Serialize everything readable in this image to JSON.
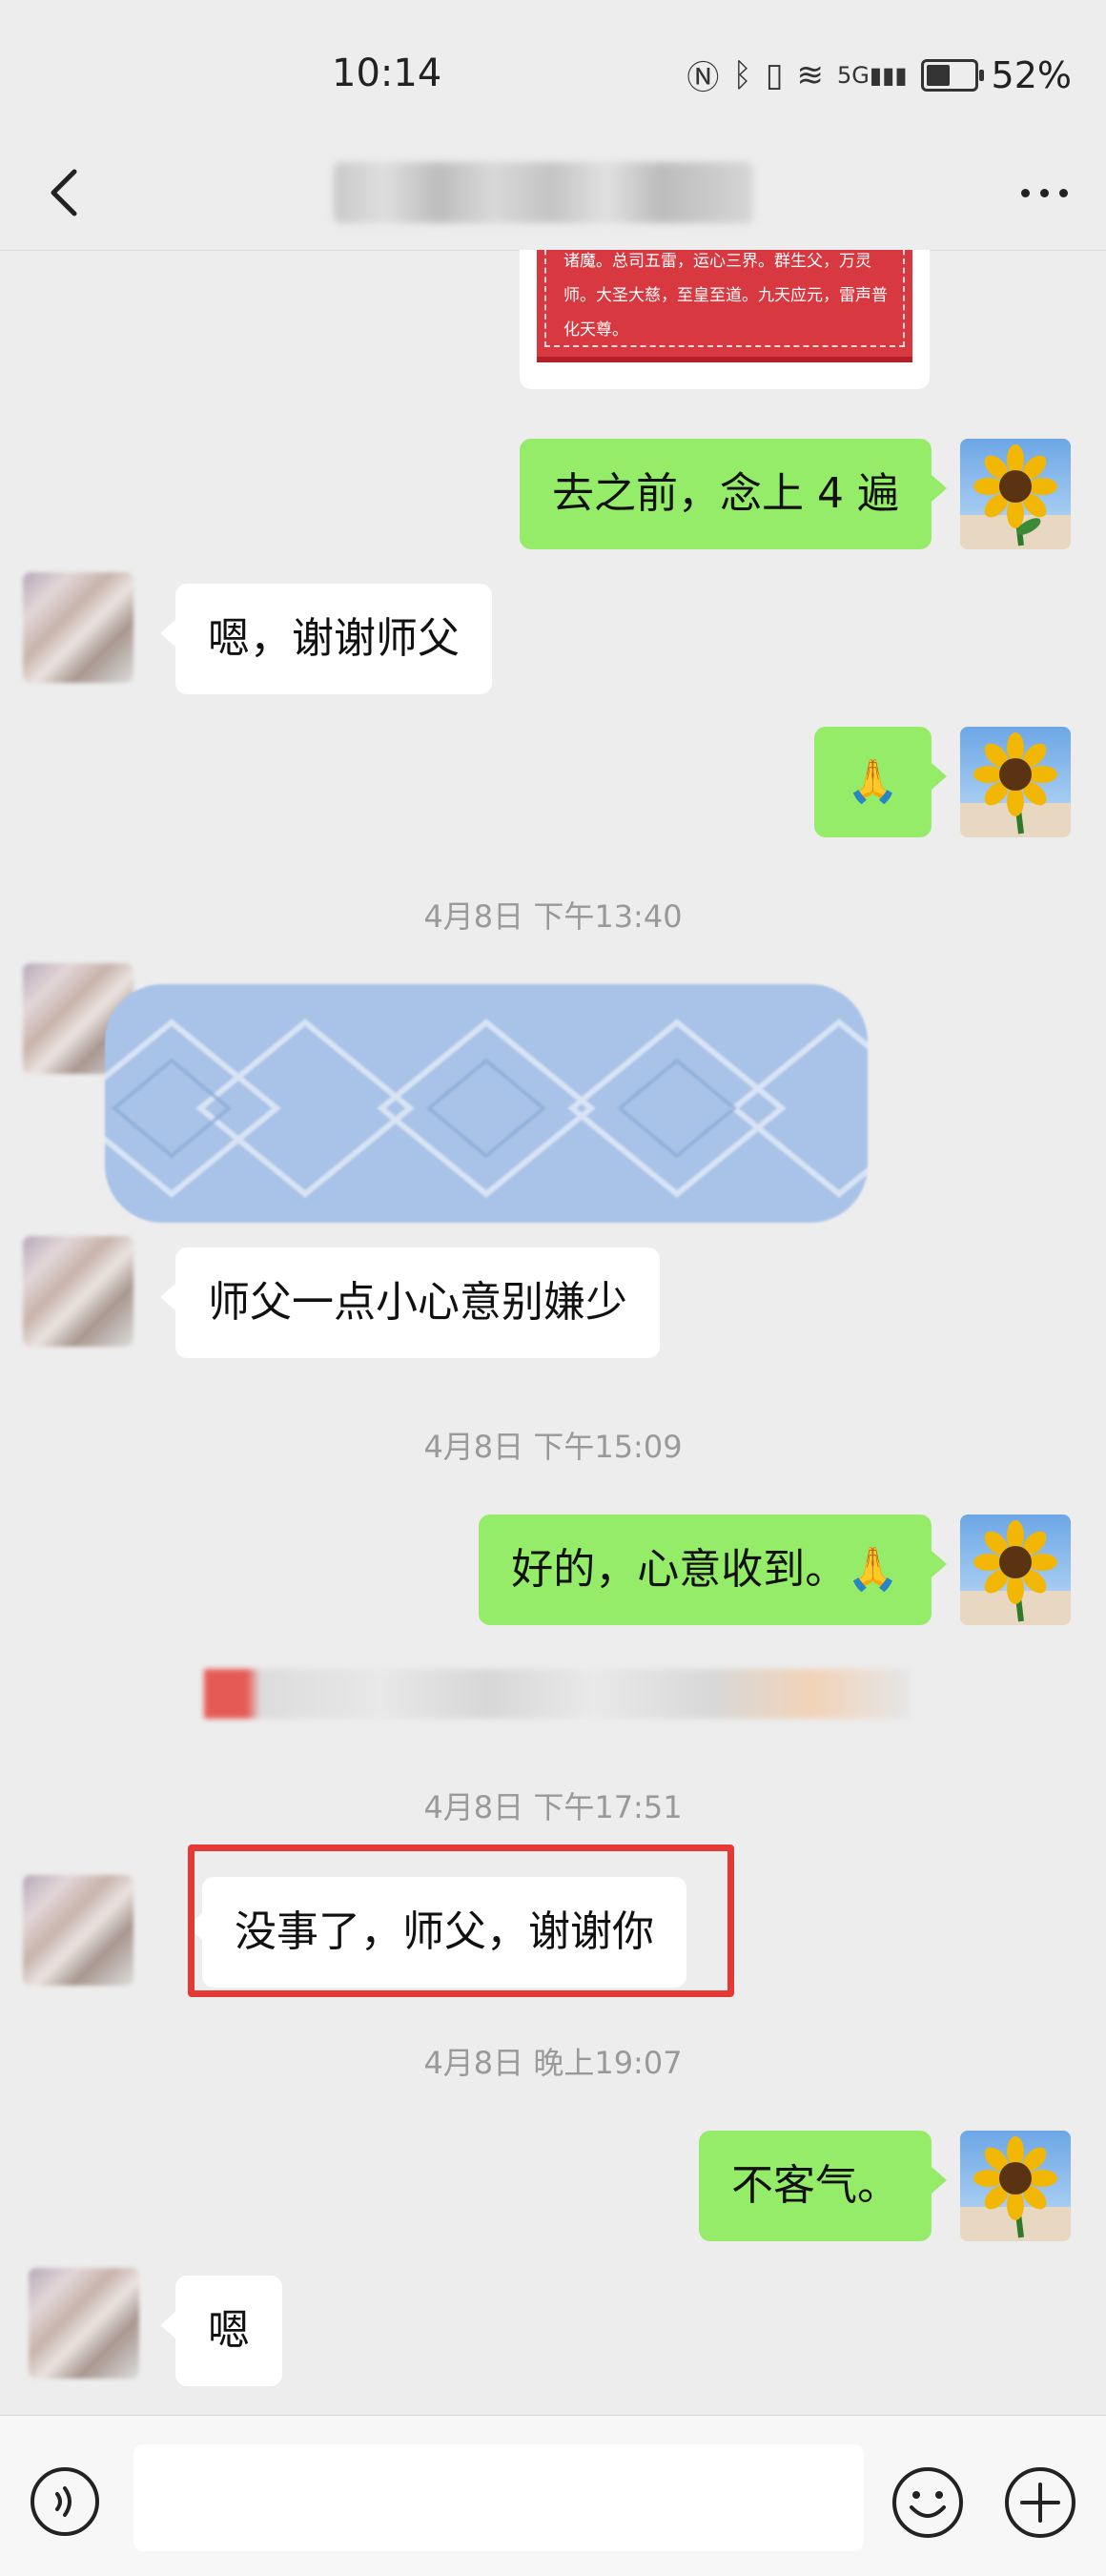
{
  "status_bar": {
    "time": "10:14",
    "signal_label": "5G",
    "battery": "52%"
  },
  "header": {
    "back_icon": "chevron-left-icon",
    "more_icon": "more-dots-icon"
  },
  "image_card": {
    "text": "诸魔。总司五雷，运心三界。群生父，万灵师。大圣大慈，至皇至道。九天应元，雷声普化天尊。"
  },
  "messages": {
    "m1": "去之前，念上 4 遍",
    "m2": "嗯，谢谢师父",
    "m3": "🙏",
    "t1": "4月8日 下午13:40",
    "m4": "师父一点小心意别嫌少",
    "t2": "4月8日 下午15:09",
    "m5": "好的，心意收到。🙏",
    "t3": "4月8日 下午17:51",
    "m6": "没事了，师父，谢谢你",
    "t4": "4月8日 晚上19:07",
    "m7": "不客气。",
    "m8": "嗯"
  },
  "colors": {
    "outgoing_bubble": "#95ec69",
    "incoming_bubble": "#ffffff",
    "highlight": "#e53935",
    "background": "#ededed"
  },
  "input_bar": {
    "voice_icon": "voice-icon",
    "emoji_icon": "emoji-icon",
    "plus_icon": "plus-icon"
  }
}
